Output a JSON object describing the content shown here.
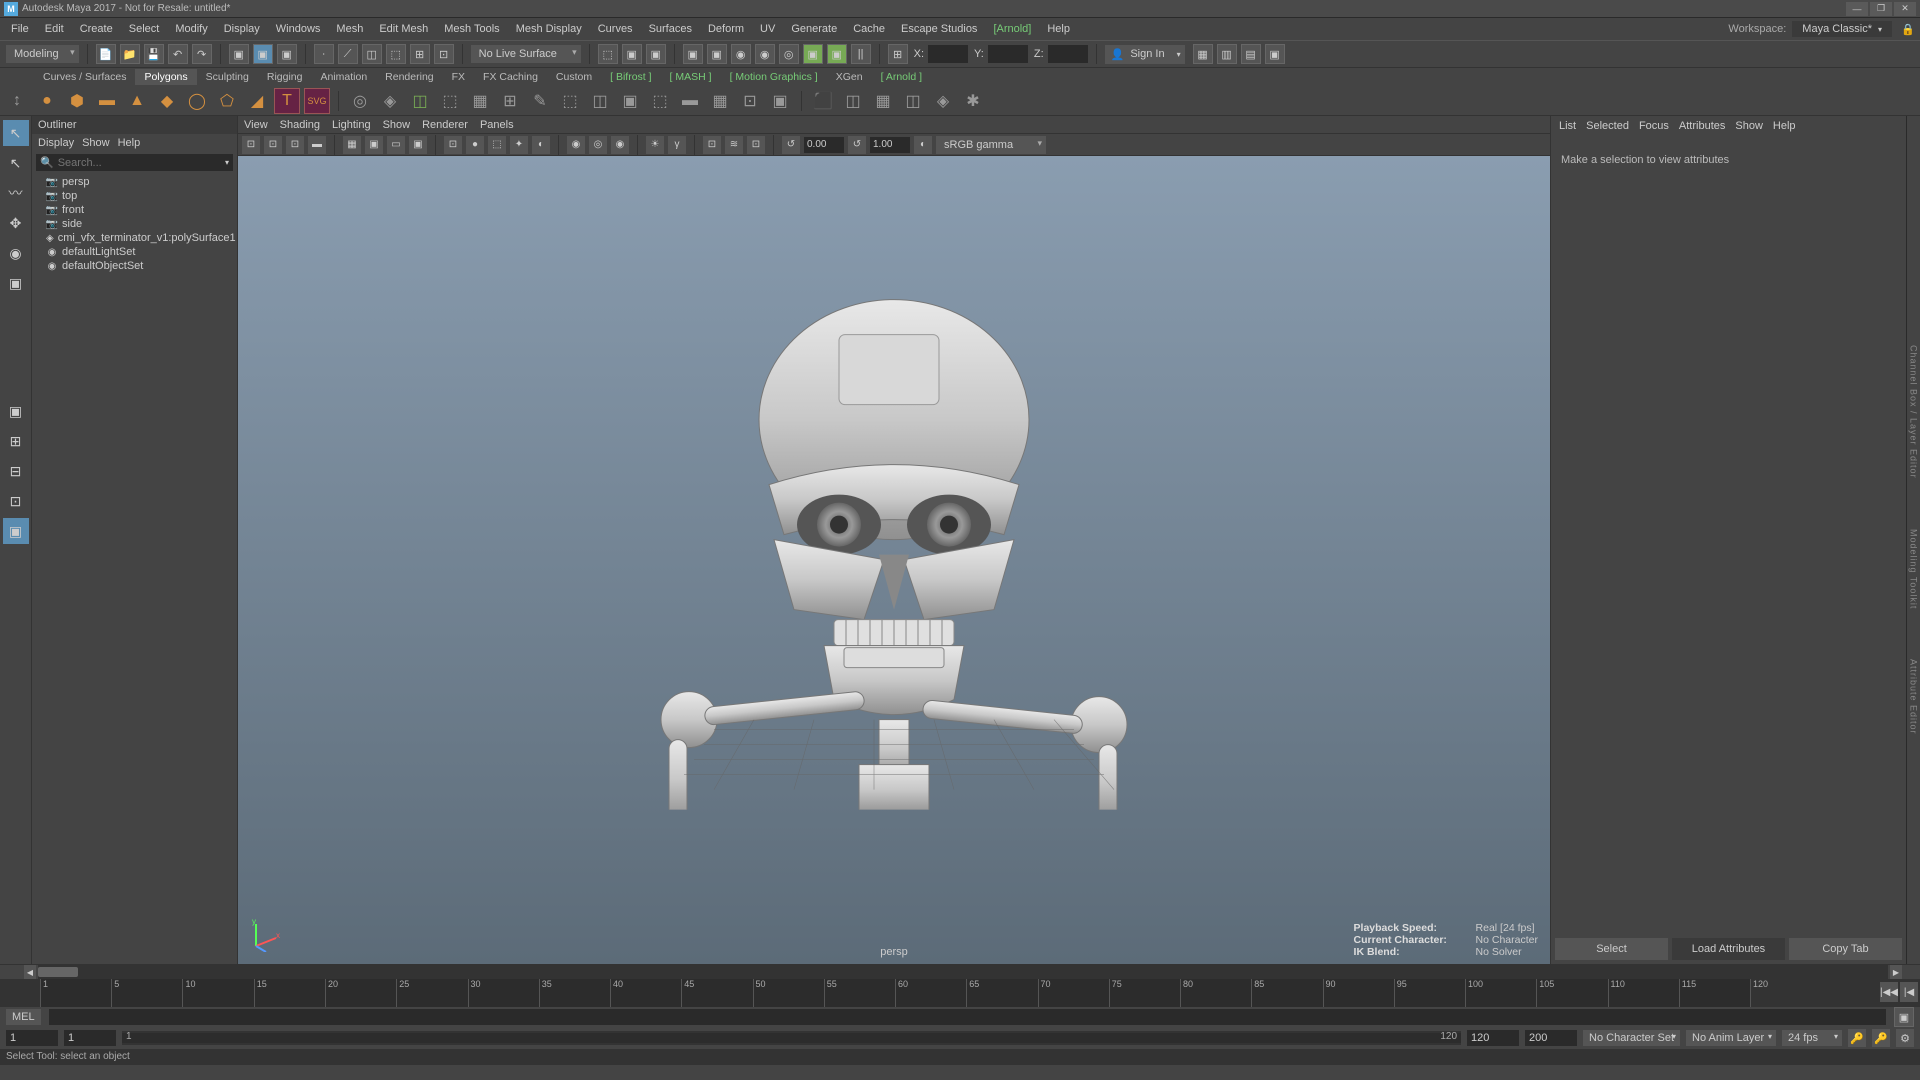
{
  "window": {
    "title": "Autodesk Maya 2017 - Not for Resale: untitled*",
    "minimize": "—",
    "restore": "❐",
    "close": "✕"
  },
  "menubar": {
    "items": [
      "File",
      "Edit",
      "Create",
      "Select",
      "Modify",
      "Display",
      "Windows",
      "Mesh",
      "Edit Mesh",
      "Mesh Tools",
      "Mesh Display",
      "Curves",
      "Surfaces",
      "Deform",
      "UV",
      "Generate",
      "Cache",
      "Escape Studios"
    ],
    "arnold": "[Arnold]",
    "help": "Help",
    "workspace_label": "Workspace:",
    "workspace_value": "Maya Classic*"
  },
  "toolbar": {
    "mode": "Modeling",
    "live": "No Live Surface",
    "x": "X:",
    "y": "Y:",
    "z": "Z:",
    "signin": "Sign In"
  },
  "shelf": {
    "tabs": [
      "Curves / Surfaces",
      "Polygons",
      "Sculpting",
      "Rigging",
      "Animation",
      "Rendering",
      "FX",
      "FX Caching",
      "Custom"
    ],
    "bifrost": "Bifrost",
    "mash": "MASH",
    "mg": "Motion Graphics",
    "xgen": "XGen",
    "arnold": "Arnold"
  },
  "outliner": {
    "title": "Outliner",
    "menus": [
      "Display",
      "Show",
      "Help"
    ],
    "search_ph": "Search...",
    "items": [
      {
        "icon": "cam",
        "label": "persp"
      },
      {
        "icon": "cam",
        "label": "top"
      },
      {
        "icon": "cam",
        "label": "front"
      },
      {
        "icon": "cam",
        "label": "side"
      },
      {
        "icon": "mesh",
        "label": "cmi_vfx_terminator_v1:polySurface1"
      },
      {
        "icon": "set",
        "label": "defaultLightSet"
      },
      {
        "icon": "set",
        "label": "defaultObjectSet"
      }
    ]
  },
  "viewport": {
    "menus": [
      "View",
      "Shading",
      "Lighting",
      "Show",
      "Renderer",
      "Panels"
    ],
    "persp": "persp",
    "num1": "0.00",
    "num2": "1.00",
    "cmode": "sRGB gamma",
    "info": {
      "speed_l": "Playback Speed:",
      "speed_v": "Real [24 fps]",
      "char_l": "Current Character:",
      "char_v": "No Character",
      "ik_l": "IK Blend:",
      "ik_v": "No Solver"
    }
  },
  "right": {
    "tabs": [
      "List",
      "Selected",
      "Focus",
      "Attributes",
      "Show",
      "Help"
    ],
    "msg": "Make a selection to view attributes",
    "sel": "Select",
    "load": "Load Attributes",
    "copy": "Copy Tab"
  },
  "rightStrip": {
    "t1": "Channel Box / Layer Editor",
    "t2": "Modeling Toolkit",
    "t3": "Attribute Editor"
  },
  "timeline": {
    "ticks": [
      1,
      5,
      10,
      15,
      20,
      25,
      30,
      35,
      40,
      45,
      50,
      55,
      60,
      65,
      70,
      75,
      80,
      85,
      90,
      95,
      100,
      105,
      110,
      115,
      120
    ],
    "frame": "1"
  },
  "range": {
    "start_out": "1",
    "start_in": "1",
    "label_start": "1",
    "label_end": "120",
    "end_in": "120",
    "end_out": "200",
    "charset": "No Character Set",
    "animlayer": "No Anim Layer",
    "fps": "24 fps"
  },
  "cmd": {
    "mel": "MEL"
  },
  "status": "Select Tool: select an object"
}
